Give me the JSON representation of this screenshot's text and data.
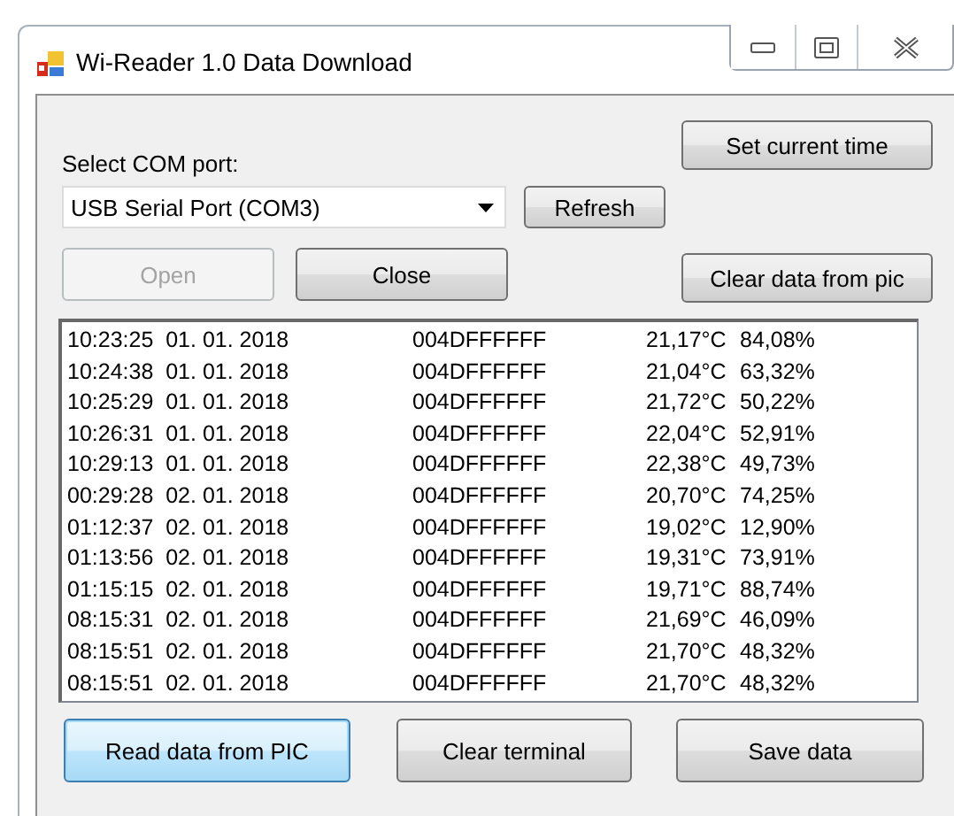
{
  "window": {
    "title": "Wi-Reader 1.0 Data Download"
  },
  "port": {
    "label": "Select COM port:",
    "value": "USB Serial Port (COM3)"
  },
  "set_time_button": {
    "label": "Set current time",
    "disabled": false
  },
  "refresh_button": {
    "label": "Refresh",
    "disabled": false
  },
  "open_button": {
    "label": "Open",
    "disabled": true
  },
  "close_button": {
    "label": "Close",
    "disabled": false
  },
  "clear_pic_button": {
    "label": "Clear data from pic",
    "disabled": false
  },
  "log": [
    {
      "timestamp": "10:23:25  01. 01. 2018",
      "device": "004DFFFFFF",
      "temperature": "21,17°C",
      "humidity": "84,08%"
    },
    {
      "timestamp": "10:24:38  01. 01. 2018",
      "device": "004DFFFFFF",
      "temperature": "21,04°C",
      "humidity": "63,32%"
    },
    {
      "timestamp": "10:25:29  01. 01. 2018",
      "device": "004DFFFFFF",
      "temperature": "21,72°C",
      "humidity": "50,22%"
    },
    {
      "timestamp": "10:26:31  01. 01. 2018",
      "device": "004DFFFFFF",
      "temperature": "22,04°C",
      "humidity": "52,91%"
    },
    {
      "timestamp": "10:29:13  01. 01. 2018",
      "device": "004DFFFFFF",
      "temperature": "22,38°C",
      "humidity": "49,73%"
    },
    {
      "timestamp": "00:29:28  02. 01. 2018",
      "device": "004DFFFFFF",
      "temperature": "20,70°C",
      "humidity": "74,25%"
    },
    {
      "timestamp": "01:12:37  02. 01. 2018",
      "device": "004DFFFFFF",
      "temperature": "19,02°C",
      "humidity": "12,90%"
    },
    {
      "timestamp": "01:13:56  02. 01. 2018",
      "device": "004DFFFFFF",
      "temperature": "19,31°C",
      "humidity": "73,91%"
    },
    {
      "timestamp": "01:15:15  02. 01. 2018",
      "device": "004DFFFFFF",
      "temperature": "19,71°C",
      "humidity": "88,74%"
    },
    {
      "timestamp": "08:15:31  02. 01. 2018",
      "device": "004DFFFFFF",
      "temperature": "21,69°C",
      "humidity": "46,09%"
    },
    {
      "timestamp": "08:15:51  02. 01. 2018",
      "device": "004DFFFFFF",
      "temperature": "21,70°C",
      "humidity": "48,32%"
    },
    {
      "timestamp": "08:15:51  02. 01. 2018",
      "device": "004DFFFFFF",
      "temperature": "21,70°C",
      "humidity": "48,32%"
    }
  ],
  "bottom_buttons": [
    {
      "label": "Read data from PIC",
      "focused": true
    },
    {
      "label": "Clear terminal",
      "focused": false
    },
    {
      "label": "Save data",
      "focused": false
    }
  ]
}
